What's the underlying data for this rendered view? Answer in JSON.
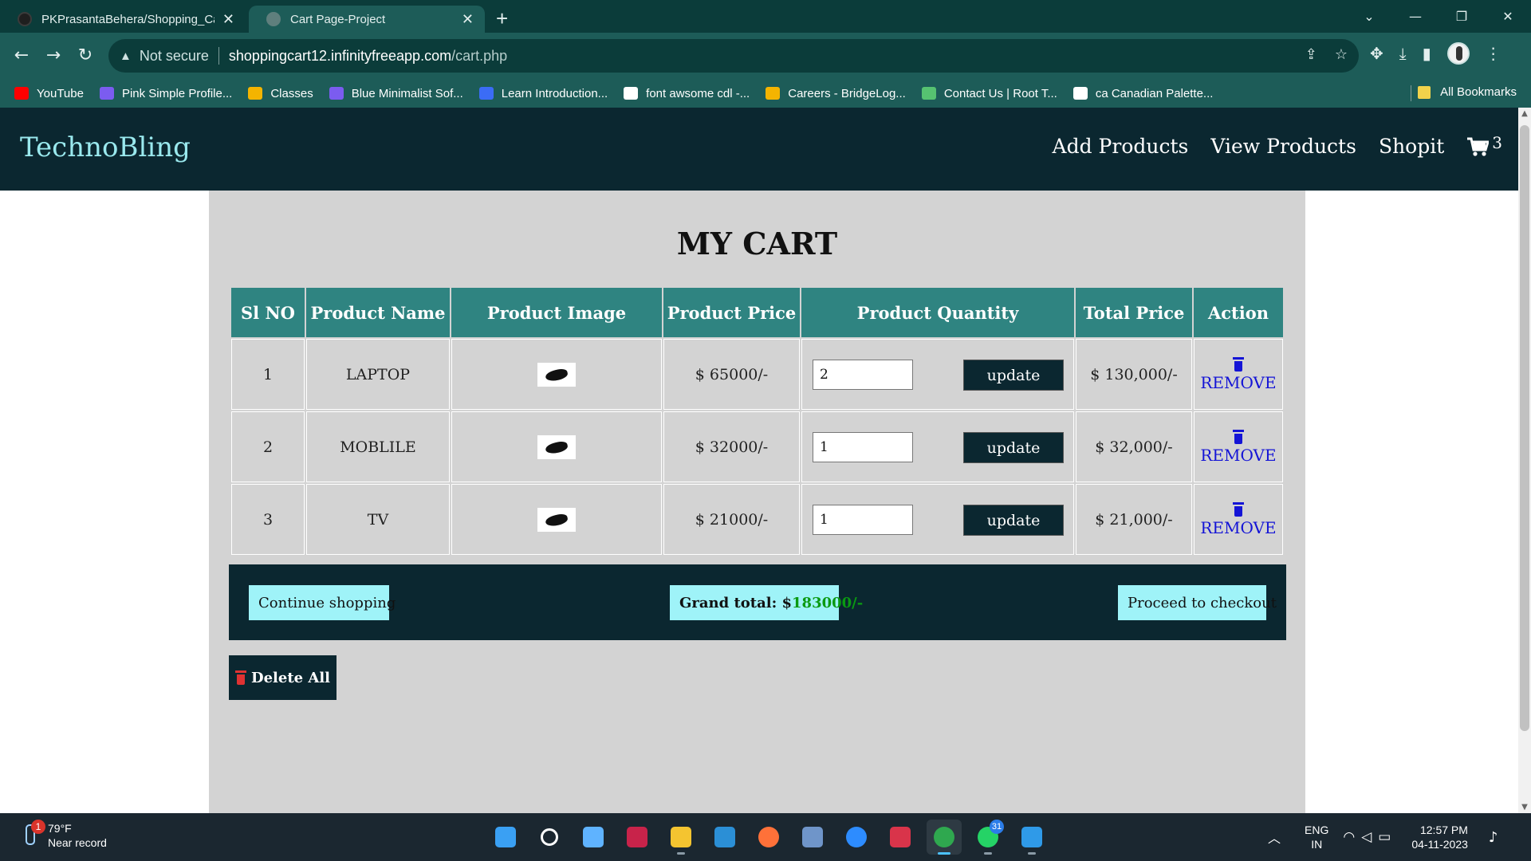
{
  "browser": {
    "tabs": [
      {
        "title": "PKPrasantaBehera/Shopping_Ca",
        "close": "✕"
      },
      {
        "title": "Cart Page-Project",
        "close": "✕"
      }
    ],
    "new_tab": "+",
    "window_controls": {
      "dropdown": "⌄",
      "minimize": "—",
      "restore": "❐",
      "close": "✕"
    },
    "nav": {
      "back": "←",
      "forward": "→",
      "reload": "↻"
    },
    "address": {
      "security_label": "Not secure",
      "url_host": "shoppingcart12.infinityfreeapp.com",
      "url_path": "/cart.php"
    },
    "bookmarks": [
      {
        "label": "YouTube",
        "color": "#ff0000"
      },
      {
        "label": "Pink Simple Profile...",
        "color": "#7b5cf0"
      },
      {
        "label": "Classes",
        "color": "#f4b400"
      },
      {
        "label": "Blue Minimalist Sof...",
        "color": "#7b5cf0"
      },
      {
        "label": "Learn Introduction...",
        "color": "#3b6cf6"
      },
      {
        "label": "font awsome cdl -...",
        "color": "#ffffff"
      },
      {
        "label": "Careers - BridgeLog...",
        "color": "#f4b400"
      },
      {
        "label": "Contact Us | Root T...",
        "color": "#56c271"
      },
      {
        "label": "ca Canadian Palette...",
        "color": "#ffffff"
      }
    ],
    "all_bookmarks": "All Bookmarks"
  },
  "site": {
    "brand": "TechnoBling",
    "nav": {
      "add_products": "Add Products",
      "view_products": "View Products",
      "shopit": "Shopit",
      "cart_count": "3"
    },
    "cart_title": "MY CART",
    "table_headers": [
      "Sl NO",
      "Product Name",
      "Product Image",
      "Product Price",
      "Product Quantity",
      "Total Price",
      "Action"
    ],
    "rows": [
      {
        "sl": "1",
        "name": "LAPTOP",
        "price": "$ 65000/-",
        "qty": "2",
        "update": "update",
        "total": "$ 130,000/-",
        "action": "REMOVE"
      },
      {
        "sl": "2",
        "name": "MOBLILE",
        "price": "$ 32000/-",
        "qty": "1",
        "update": "update",
        "total": "$ 32,000/-",
        "action": "REMOVE"
      },
      {
        "sl": "3",
        "name": "TV",
        "price": "$ 21000/-",
        "qty": "1",
        "update": "update",
        "total": "$ 21,000/-",
        "action": "REMOVE"
      }
    ],
    "summary": {
      "continue": "Continue shopping",
      "grand_total_label": "Grand total: $",
      "grand_total_value": "183000/-",
      "checkout": "Proceed to checkout"
    },
    "delete_all": "Delete All"
  },
  "colors": {
    "navbar": "#0b2730",
    "brand": "#9ae9ee",
    "table_header": "#2f8481",
    "page_bg": "#d3d3d3",
    "light_button": "#9ff3f8",
    "remove_link": "#1414d6",
    "grand_total_value": "#0a9a12",
    "delete_icon": "#e03232"
  },
  "taskbar": {
    "weather": {
      "temp": "79°F",
      "desc": "Near record",
      "badge": "1"
    },
    "apps": [
      "start-icon",
      "search-icon",
      "copilot-icon",
      "clipchamp-icon",
      "file-explorer-icon",
      "myhp-icon",
      "firefox-icon",
      "postgresql-icon",
      "zoom-icon",
      "recorder-icon",
      "chrome-icon",
      "whatsapp-icon",
      "vscode-icon"
    ],
    "whatsapp_badge": "31",
    "language": {
      "line1": "ENG",
      "line2": "IN"
    },
    "clock": {
      "time": "12:57 PM",
      "date": "04-11-2023"
    }
  }
}
